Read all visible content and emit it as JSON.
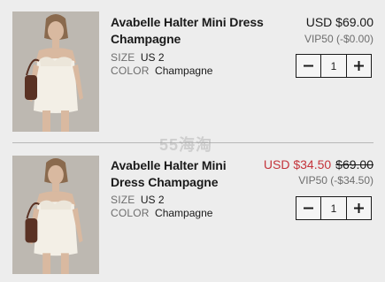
{
  "items": [
    {
      "name": "Avabelle Halter Mini Dress Champagne",
      "size_label": "SIZE",
      "size_value": "US 2",
      "color_label": "COLOR",
      "color_value": "Champagne",
      "price": "USD $69.00",
      "promo": "VIP50 (-$0.00)",
      "quantity": "1",
      "minus_icon": "minus-icon",
      "plus_icon": "plus-icon"
    },
    {
      "name": "Avabelle Halter Mini Dress Champagne",
      "size_label": "SIZE",
      "size_value": "US 2",
      "color_label": "COLOR",
      "color_value": "Champagne",
      "sale_price": "USD $34.50",
      "original_price": "$69.00",
      "promo": "VIP50 (-$34.50)",
      "quantity": "1",
      "minus_icon": "minus-icon",
      "plus_icon": "plus-icon"
    }
  ],
  "watermark": "55海淘",
  "colors": {
    "background": "#ededed",
    "sale_red": "#c4343b",
    "muted_text": "#6e6e6e"
  }
}
